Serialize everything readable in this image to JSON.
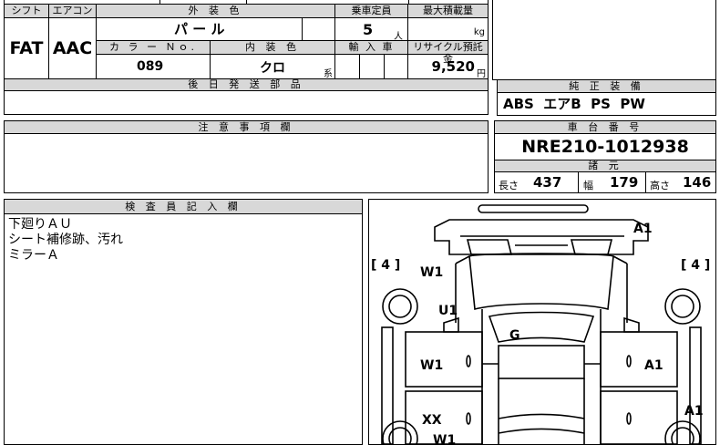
{
  "labels": {
    "shift": "シフト",
    "aircon": "エアコン",
    "exterior_color": "外 装 色",
    "capacity": "乗車定員",
    "max_load": "最大積載量",
    "color_no": "カ ラ ー Ｎｏ.",
    "interior_color": "内 装 色",
    "import": "輸 入 車",
    "recycle_fee": "リサイクル預託金",
    "later_parts": "後 日 発 送 部 品",
    "genuine_equipment": "純 正 装 備",
    "notes": "注 意 事 項 欄",
    "chassis_no": "車 台 番 号",
    "specs": "諸 元",
    "inspector_notes": "検 査 員 記 入 欄",
    "length": "長さ",
    "width": "幅",
    "height": "高さ",
    "person_unit": "人",
    "kg_unit": "kg",
    "yen_unit": "円",
    "series_suffix": "系"
  },
  "values": {
    "shift": "FAT",
    "aircon": "AAC",
    "exterior_color": "パ ー ル",
    "capacity": "5",
    "color_no": "089",
    "interior_color": "クロ",
    "recycle_fee": "9,520",
    "genuine_equipment": "ABS  エアB  PS  PW",
    "chassis_no": "NRE210-1012938",
    "length": "437",
    "width": "179",
    "height": "146"
  },
  "inspector_notes": [
    "下廻りＡＵ",
    "シート補修跡、汚れ",
    "ミラーＡ"
  ],
  "diagram": {
    "codes": {
      "front_right": "A1",
      "tire_left": "[ 4 ]",
      "tire_right": "[ 4 ]",
      "front_left_fender": "W1",
      "left_pillar": "U1",
      "roof": "G",
      "left_front_door": "W1",
      "right_front_door": "A1",
      "left_rear_door": "XX",
      "right_rear": "A1",
      "left_bottom": "W1"
    }
  }
}
